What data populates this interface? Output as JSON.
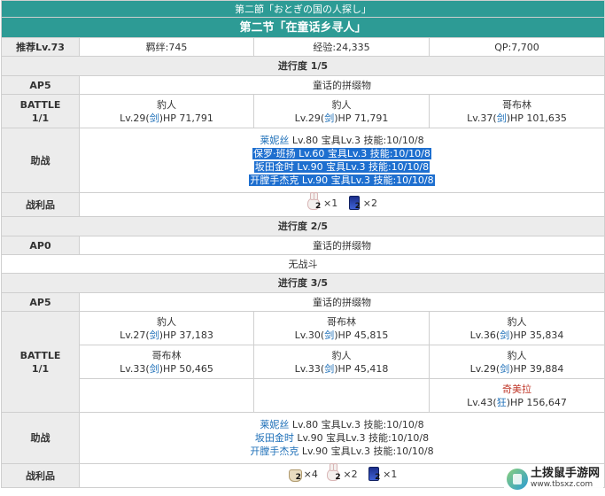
{
  "header": {
    "subtitle_jp": "第二節「おとぎの国の人探し」",
    "title_cn": "第二节「在童话乡寻人」"
  },
  "info": {
    "level": "推荐Lv.73",
    "bond": "羁绊:745",
    "exp": "经验:24,335",
    "qp": "QP:7,700"
  },
  "progress1": {
    "label": "进行度 1/5",
    "ap": "AP5",
    "quest": "童话的拼缀物",
    "battle_label": "BATTLE",
    "battle_count": "1/1",
    "enemies": [
      {
        "name": "豹人",
        "lv": "Lv.29(",
        "cls": "剑",
        "hp": ")HP 71,791"
      },
      {
        "name": "豹人",
        "lv": "Lv.29(",
        "cls": "剑",
        "hp": ")HP 71,791"
      },
      {
        "name": "哥布林",
        "lv": "Lv.37(",
        "cls": "剑",
        "hp": ")HP 101,635"
      }
    ],
    "support_label": "助战",
    "supports": [
      {
        "name": "莱妮丝",
        "rest": " Lv.80 宝具Lv.3 技能:10/10/8"
      },
      {
        "name": "保罗·班扬",
        "rest": " Lv.60 宝具Lv.3 技能:10/10/8"
      },
      {
        "name": "坂田金时",
        "rest": " Lv.90 宝具Lv.3 技能:10/10/8"
      },
      {
        "name": "开膛手杰克",
        "rest": " Lv.90 宝具Lv.3 技能:10/10/8"
      }
    ],
    "drops_label": "战利品",
    "drops": [
      {
        "icon": "rabbit-icon",
        "tier": "2",
        "count": "×1"
      },
      {
        "icon": "lantern-icon",
        "tier": "2",
        "count": "×2"
      }
    ]
  },
  "progress2": {
    "label": "进行度 2/5",
    "ap": "AP0",
    "quest": "童话的拼缀物",
    "note": "无战斗"
  },
  "progress3": {
    "label": "进行度 3/5",
    "ap": "AP5",
    "quest": "童话的拼缀物",
    "battle_label": "BATTLE",
    "battle_count": "1/1",
    "row1": [
      {
        "name": "豹人",
        "lv": "Lv.27(",
        "cls": "剑",
        "hp": ")HP 37,183"
      },
      {
        "name": "哥布林",
        "lv": "Lv.30(",
        "cls": "剑",
        "hp": ")HP 45,815"
      },
      {
        "name": "豹人",
        "lv": "Lv.36(",
        "cls": "剑",
        "hp": ")HP 35,834"
      }
    ],
    "row2": [
      {
        "name": "哥布林",
        "lv": "Lv.33(",
        "cls": "剑",
        "hp": ")HP 50,465"
      },
      {
        "name": "豹人",
        "lv": "Lv.33(",
        "cls": "剑",
        "hp": ")HP 45,418"
      },
      {
        "name": "豹人",
        "lv": "Lv.29(",
        "cls": "剑",
        "hp": ")HP 39,884"
      }
    ],
    "boss": {
      "name": "奇美拉",
      "lv": "Lv.43(",
      "cls": "狂",
      "hp": ")HP 156,647"
    },
    "support_label": "助战",
    "supports": [
      {
        "name": "莱妮丝",
        "rest": " Lv.80 宝具Lv.3 技能:10/10/8"
      },
      {
        "name": "坂田金时",
        "rest": " Lv.90 宝具Lv.3 技能:10/10/8"
      },
      {
        "name": "开膛手杰克",
        "rest": " Lv.90 宝具Lv.3 技能:10/10/8"
      }
    ],
    "drops_label": "战利品",
    "drops": [
      {
        "icon": "bag-icon",
        "tier": "2",
        "count": "×4"
      },
      {
        "icon": "rabbit-icon",
        "tier": "2",
        "count": "×2"
      },
      {
        "icon": "lantern-icon",
        "tier": "2",
        "count": "×1"
      }
    ]
  },
  "watermark": {
    "title": "土拨鼠手游网",
    "url": "www.tbsxz.com"
  },
  "colors": {
    "header_bg": "#2d9b95",
    "label_bg": "#ececec",
    "link_blue": "#1d6fb8",
    "boss_red": "#c0392b",
    "highlight": "#1e6fcf"
  }
}
